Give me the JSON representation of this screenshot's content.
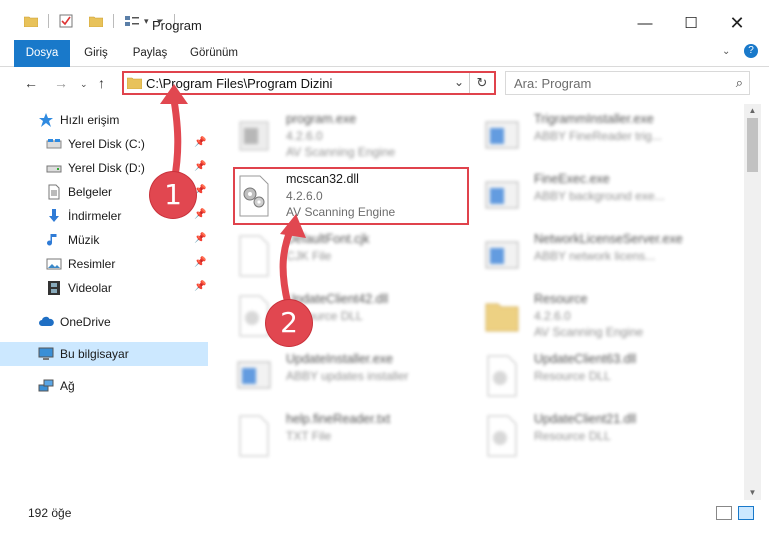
{
  "window": {
    "title": "Program"
  },
  "ribbon": {
    "tabs": [
      "Dosya",
      "Giriş",
      "Paylaş",
      "Görünüm"
    ]
  },
  "address": {
    "path": "C:\\Program Files\\Program Dizini"
  },
  "search": {
    "placeholder": "Ara: Program"
  },
  "sidebar": {
    "items": [
      {
        "label": "Hızlı erişim",
        "pinned": false
      },
      {
        "label": "Yerel Disk (C:)",
        "pinned": true
      },
      {
        "label": "Yerel Disk (D:)",
        "pinned": true
      },
      {
        "label": "Belgeler",
        "pinned": true
      },
      {
        "label": "İndirmeler",
        "pinned": true
      },
      {
        "label": "Müzik",
        "pinned": true
      },
      {
        "label": "Resimler",
        "pinned": true
      },
      {
        "label": "Videolar",
        "pinned": true
      },
      {
        "label": "OneDrive",
        "pinned": false
      },
      {
        "label": "Bu bilgisayar",
        "pinned": false
      },
      {
        "label": "Ağ",
        "pinned": false
      }
    ]
  },
  "files": {
    "left": [
      {
        "name": "program.exe",
        "line1": "4.2.6.0",
        "line2": "AV Scanning Engine"
      },
      {
        "name": "mcscan32.dll",
        "line1": "4.2.6.0",
        "line2": "AV Scanning Engine"
      },
      {
        "name": "DefaultFont.cjk",
        "line1": "CJK File",
        "line2": ""
      },
      {
        "name": "UpdateClient42.dll",
        "line1": "Resource DLL",
        "line2": ""
      },
      {
        "name": "UpdateInstaller.exe",
        "line1": "ABBY updates installer",
        "line2": ""
      },
      {
        "name": "help.fineReader.txt",
        "line1": "TXT File",
        "line2": ""
      }
    ],
    "right": [
      {
        "name": "TrigrammInstaller.exe",
        "line1": "ABBY FineReader trig...",
        "line2": ""
      },
      {
        "name": "FineExec.exe",
        "line1": "ABBY background exe...",
        "line2": ""
      },
      {
        "name": "NetworkLicenseServer.exe",
        "line1": "ABBY network licens...",
        "line2": ""
      },
      {
        "name": "Resource",
        "line1": "4.2.6.0",
        "line2": "AV Scanning Engine"
      },
      {
        "name": "UpdateClient63.dll",
        "line1": "Resource DLL",
        "line2": ""
      },
      {
        "name": "UpdateClient21.dll",
        "line1": "Resource DLL",
        "line2": ""
      }
    ]
  },
  "status": {
    "count": "192 öğe"
  },
  "annotations": {
    "badge1": "1",
    "badge2": "2"
  },
  "colors": {
    "accent": "#1979ca",
    "highlight": "#e0434c",
    "selection": "#cce8ff"
  }
}
